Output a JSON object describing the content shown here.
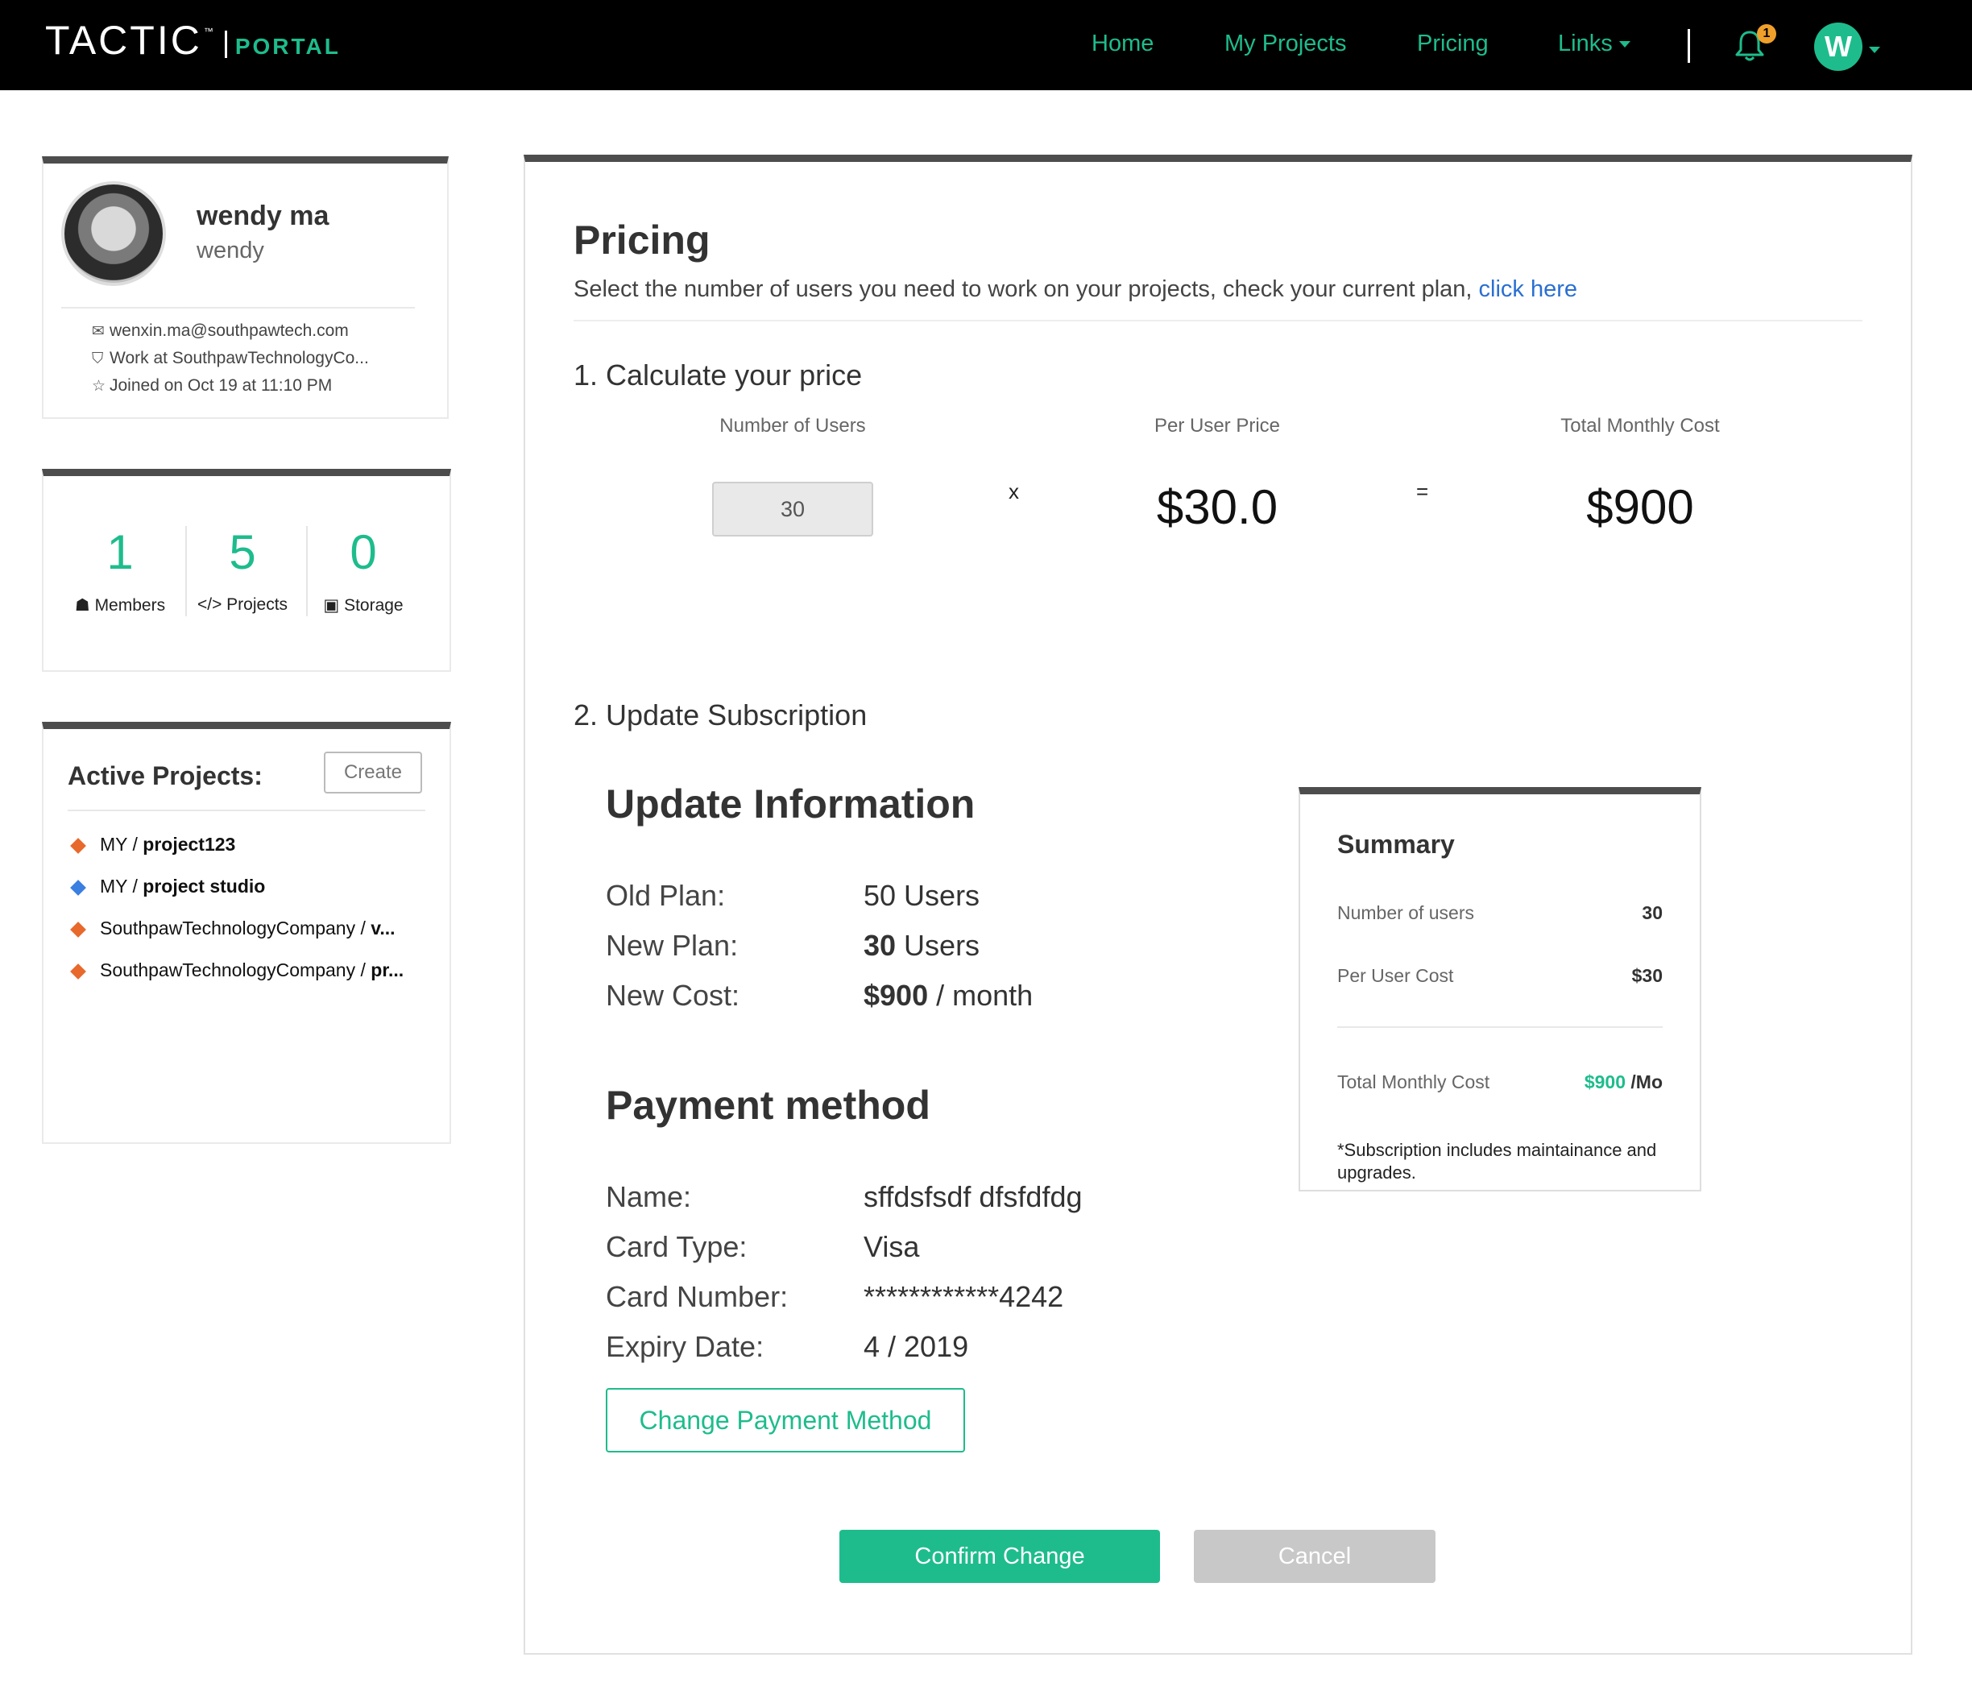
{
  "header": {
    "logo_main": "TACTIC",
    "logo_tm": "™",
    "logo_sub": "PORTAL",
    "nav": {
      "home": "Home",
      "my_projects": "My Projects",
      "pricing": "Pricing",
      "links": "Links"
    },
    "notification_count": "1",
    "user_initial": "W"
  },
  "profile": {
    "name": "wendy ma",
    "username": "wendy",
    "email": "wenxin.ma@southpawtech.com",
    "work": "Work at SouthpawTechnologyCo...",
    "joined": "Joined on Oct 19 at 11:10 PM"
  },
  "stats": [
    {
      "value": "1",
      "label": "Members",
      "icon": "user-icon"
    },
    {
      "value": "5",
      "label": "Projects",
      "icon": "code-icon"
    },
    {
      "value": "0",
      "label": "Storage",
      "icon": "floppy-disk-icon"
    }
  ],
  "projects": {
    "title": "Active Projects:",
    "create_label": "Create",
    "items": [
      {
        "prefix": "MY / ",
        "name": "project123",
        "color": "#e8692c"
      },
      {
        "prefix": "MY / ",
        "name": "project studio",
        "color": "#3b7fe0"
      },
      {
        "prefix": "SouthpawTechnologyCompany / ",
        "name": "v...",
        "color": "#e8692c"
      },
      {
        "prefix": "SouthpawTechnologyCompany / ",
        "name": "pr...",
        "color": "#e8692c"
      }
    ]
  },
  "pricing": {
    "title": "Pricing",
    "description": "Select the number of users you need to work on your projects, check your current plan, ",
    "link": "click here",
    "step1": "1. Calculate your price",
    "col_users": "Number of Users",
    "col_price": "Per User Price",
    "col_total": "Total Monthly Cost",
    "users_value": "30",
    "times": "x",
    "equals": "=",
    "per_user_price": "$30.0",
    "total_cost": "$900",
    "step2": "2. Update Subscription"
  },
  "update": {
    "title": "Update Information",
    "old_plan_label": "Old Plan:",
    "old_plan_value": "50 Users",
    "new_plan_label": "New Plan:",
    "new_plan_num": "30",
    "new_plan_unit": " Users",
    "new_cost_label": "New Cost:",
    "new_cost_num": "$900",
    "new_cost_unit": " / month"
  },
  "payment": {
    "title": "Payment method",
    "name_label": "Name:",
    "name_value": "sffdsfsdf dfsfdfdg",
    "card_type_label": "Card Type:",
    "card_type_value": "Visa",
    "card_number_label": "Card Number:",
    "card_number_value": "************4242",
    "expiry_label": "Expiry Date:",
    "expiry_value": "4 / 2019",
    "change_button": "Change Payment Method"
  },
  "summary": {
    "title": "Summary",
    "users_label": "Number of users",
    "users_value": "30",
    "per_user_label": "Per User Cost",
    "per_user_value": "$30",
    "total_label": "Total Monthly Cost",
    "total_value": "$900",
    "total_unit": " /Mo",
    "note": "*Subscription includes maintainance and upgrades."
  },
  "actions": {
    "confirm": "Confirm Change",
    "cancel": "Cancel"
  },
  "colors": {
    "accent": "#1ebc8c",
    "link": "#2a6fd1",
    "header_bg": "#000000",
    "badge": "#f0a02a"
  }
}
